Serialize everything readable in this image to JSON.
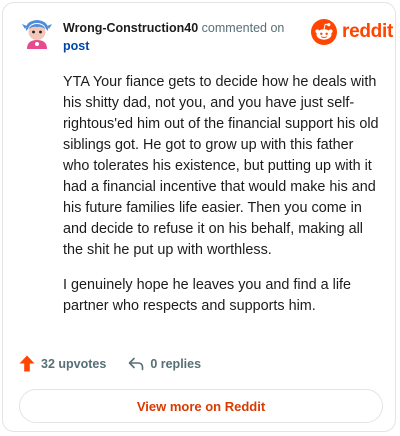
{
  "comment": {
    "username": "Wrong-Construction40",
    "action_text": "commented on",
    "target_link": "post",
    "paragraphs": [
      "YTA Your fiance gets to decide how he deals with his shitty dad, not you, and you have just self-rightous'ed him out of the financial support his old siblings got. He got to grow up with this father who tolerates his existence, but putting up with it had a financial incentive that would make his and his future families life easier. Then you come in and decide to refuse it on his behalf, making all the shit he put up with worthless.",
      "I genuinely hope he leaves you and find a life partner who respects and supports him."
    ]
  },
  "brand": {
    "wordmark": "reddit",
    "color": "#ff4500"
  },
  "footer": {
    "upvotes_label": "32 upvotes",
    "replies_label": "0 replies",
    "view_more_label": "View more on Reddit"
  },
  "icons": {
    "avatar": "avatar-icon",
    "logo": "reddit-snoo-icon",
    "upvote": "upvote-arrow-icon",
    "reply": "reply-arrow-icon"
  }
}
